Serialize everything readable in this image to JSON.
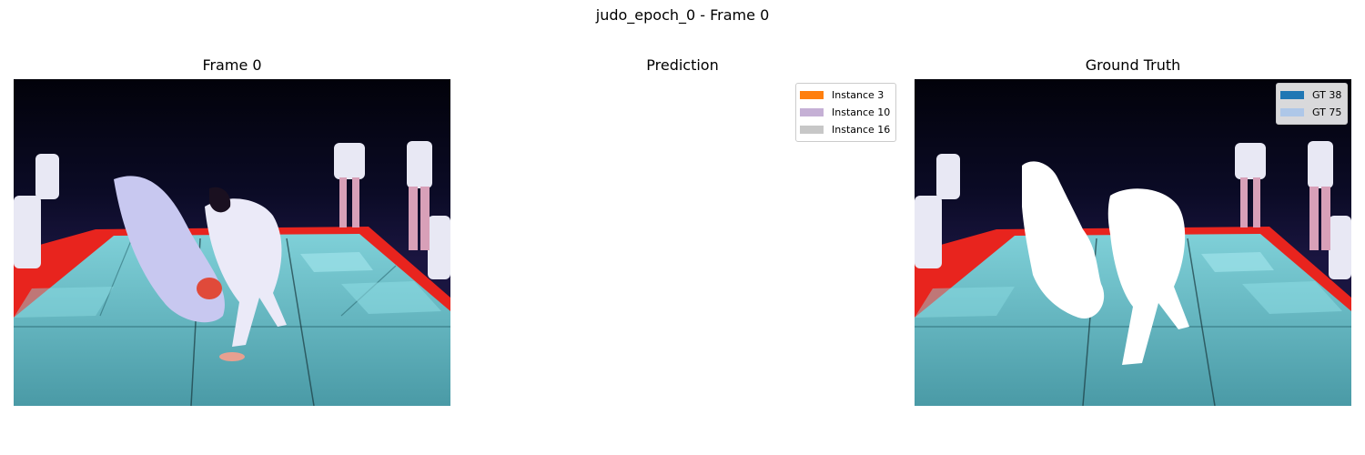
{
  "figure": {
    "suptitle": "judo_epoch_0 - Frame 0"
  },
  "panels": [
    {
      "title": "Frame 0"
    },
    {
      "title": "Prediction"
    },
    {
      "title": "Ground Truth"
    }
  ],
  "prediction_legend": [
    {
      "label": "Instance 3",
      "color": "#ff7f0e"
    },
    {
      "label": "Instance 10",
      "color": "#c5b0d5"
    },
    {
      "label": "Instance 16",
      "color": "#c7c7c7"
    }
  ],
  "ground_truth_legend": [
    {
      "label": "GT 38",
      "color": "#1f77b4"
    },
    {
      "label": "GT 75",
      "color": "#aec7e8"
    }
  ],
  "colors": {
    "mat_teal": "#5fb4c0",
    "mat_red": "#e8241e",
    "background_dark": "#0a0a1e",
    "gt_mask": "#ffffff"
  }
}
